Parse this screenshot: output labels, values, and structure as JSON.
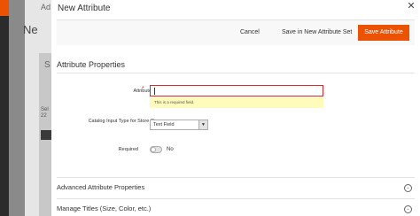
{
  "background": {
    "text_ad": "Ad",
    "text_ne": "Ne",
    "text_s": "S",
    "text_sel": "Sel\n22"
  },
  "modal": {
    "title": "New Attribute",
    "close_icon": "close-icon"
  },
  "actions": {
    "cancel_label": "Cancel",
    "save_in_set_label": "Save in New Attribute Set",
    "save_label": "Save Attribute"
  },
  "section": {
    "title": "Attribute Properties"
  },
  "fields": {
    "attribute_label": {
      "label": "Attribute Label",
      "required_marker": "*",
      "value": "",
      "error": "This is a required field."
    },
    "input_type": {
      "label": "Catalog Input Type for Store Owner",
      "value": "Text Field"
    },
    "required": {
      "label": "Required",
      "value": "No"
    }
  },
  "collapsibles": {
    "advanced": "Advanced Attribute Properties",
    "titles": "Manage Titles (Size, Color, etc.)"
  },
  "colors": {
    "accent": "#eb5202",
    "error": "#e22626",
    "error_bg": "#fffbbb"
  }
}
